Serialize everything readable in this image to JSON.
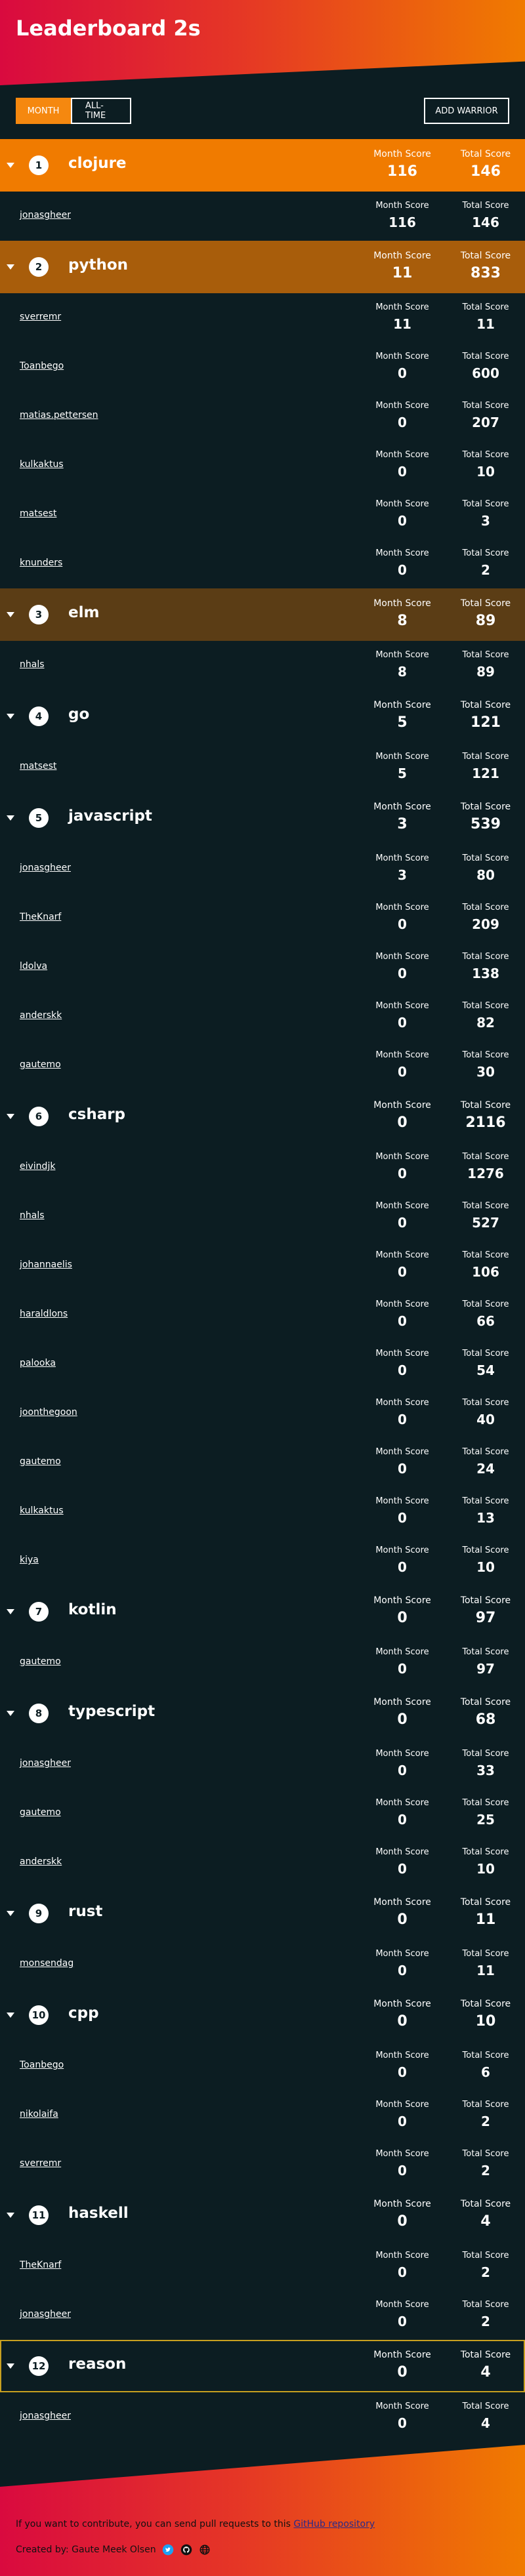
{
  "header": {
    "title": "Leaderboard 2s"
  },
  "controls": {
    "tab_month": "MONTH",
    "tab_all_time": "ALL-TIME",
    "add_warrior": "ADD WARRIOR"
  },
  "labels": {
    "month_score": "Month Score",
    "total_score": "Total Score"
  },
  "languages": [
    {
      "rank": "1",
      "name": "clojure",
      "month": "116",
      "total": "146",
      "users": [
        {
          "name": "jonasgheer",
          "month": "116",
          "total": "146"
        }
      ]
    },
    {
      "rank": "2",
      "name": "python",
      "month": "11",
      "total": "833",
      "users": [
        {
          "name": "sverremr",
          "month": "11",
          "total": "11"
        },
        {
          "name": "Toanbego",
          "month": "0",
          "total": "600"
        },
        {
          "name": "matias.pettersen",
          "month": "0",
          "total": "207"
        },
        {
          "name": "kulkaktus",
          "month": "0",
          "total": "10"
        },
        {
          "name": "matsest",
          "month": "0",
          "total": "3"
        },
        {
          "name": "knunders",
          "month": "0",
          "total": "2"
        }
      ]
    },
    {
      "rank": "3",
      "name": "elm",
      "month": "8",
      "total": "89",
      "users": [
        {
          "name": "nhals",
          "month": "8",
          "total": "89"
        }
      ]
    },
    {
      "rank": "4",
      "name": "go",
      "month": "5",
      "total": "121",
      "users": [
        {
          "name": "matsest",
          "month": "5",
          "total": "121"
        }
      ]
    },
    {
      "rank": "5",
      "name": "javascript",
      "month": "3",
      "total": "539",
      "users": [
        {
          "name": "jonasgheer",
          "month": "3",
          "total": "80"
        },
        {
          "name": "TheKnarf",
          "month": "0",
          "total": "209"
        },
        {
          "name": "ldolva",
          "month": "0",
          "total": "138"
        },
        {
          "name": "anderskk",
          "month": "0",
          "total": "82"
        },
        {
          "name": "gautemo",
          "month": "0",
          "total": "30"
        }
      ]
    },
    {
      "rank": "6",
      "name": "csharp",
      "month": "0",
      "total": "2116",
      "users": [
        {
          "name": "eivindjk",
          "month": "0",
          "total": "1276"
        },
        {
          "name": "nhals",
          "month": "0",
          "total": "527"
        },
        {
          "name": "johannaelis",
          "month": "0",
          "total": "106"
        },
        {
          "name": "haraldlons",
          "month": "0",
          "total": "66"
        },
        {
          "name": "palooka",
          "month": "0",
          "total": "54"
        },
        {
          "name": "joonthegoon",
          "month": "0",
          "total": "40"
        },
        {
          "name": "gautemo",
          "month": "0",
          "total": "24"
        },
        {
          "name": "kulkaktus",
          "month": "0",
          "total": "13"
        },
        {
          "name": "kiya",
          "month": "0",
          "total": "10"
        }
      ]
    },
    {
      "rank": "7",
      "name": "kotlin",
      "month": "0",
      "total": "97",
      "users": [
        {
          "name": "gautemo",
          "month": "0",
          "total": "97"
        }
      ]
    },
    {
      "rank": "8",
      "name": "typescript",
      "month": "0",
      "total": "68",
      "users": [
        {
          "name": "jonasgheer",
          "month": "0",
          "total": "33"
        },
        {
          "name": "gautemo",
          "month": "0",
          "total": "25"
        },
        {
          "name": "anderskk",
          "month": "0",
          "total": "10"
        }
      ]
    },
    {
      "rank": "9",
      "name": "rust",
      "month": "0",
      "total": "11",
      "users": [
        {
          "name": "monsendag",
          "month": "0",
          "total": "11"
        }
      ]
    },
    {
      "rank": "10",
      "name": "cpp",
      "month": "0",
      "total": "10",
      "users": [
        {
          "name": "Toanbego",
          "month": "0",
          "total": "6"
        },
        {
          "name": "nikolaifa",
          "month": "0",
          "total": "2"
        },
        {
          "name": "sverremr",
          "month": "0",
          "total": "2"
        }
      ]
    },
    {
      "rank": "11",
      "name": "haskell",
      "month": "0",
      "total": "4",
      "users": [
        {
          "name": "TheKnarf",
          "month": "0",
          "total": "2"
        },
        {
          "name": "jonasgheer",
          "month": "0",
          "total": "2"
        }
      ]
    },
    {
      "rank": "12",
      "name": "reason",
      "month": "0",
      "total": "4",
      "users": [
        {
          "name": "jonasgheer",
          "month": "0",
          "total": "4"
        }
      ]
    }
  ],
  "footer": {
    "contrib_text": "If you want to contribute, you can send pull requests to this ",
    "contrib_link": "GitHub repository",
    "credit": "Created by: Gaute Meek Olsen",
    "icons": [
      "twitter-icon",
      "github-icon",
      "globe-icon"
    ],
    "colors": {
      "twitter": "#1da1f2"
    }
  }
}
